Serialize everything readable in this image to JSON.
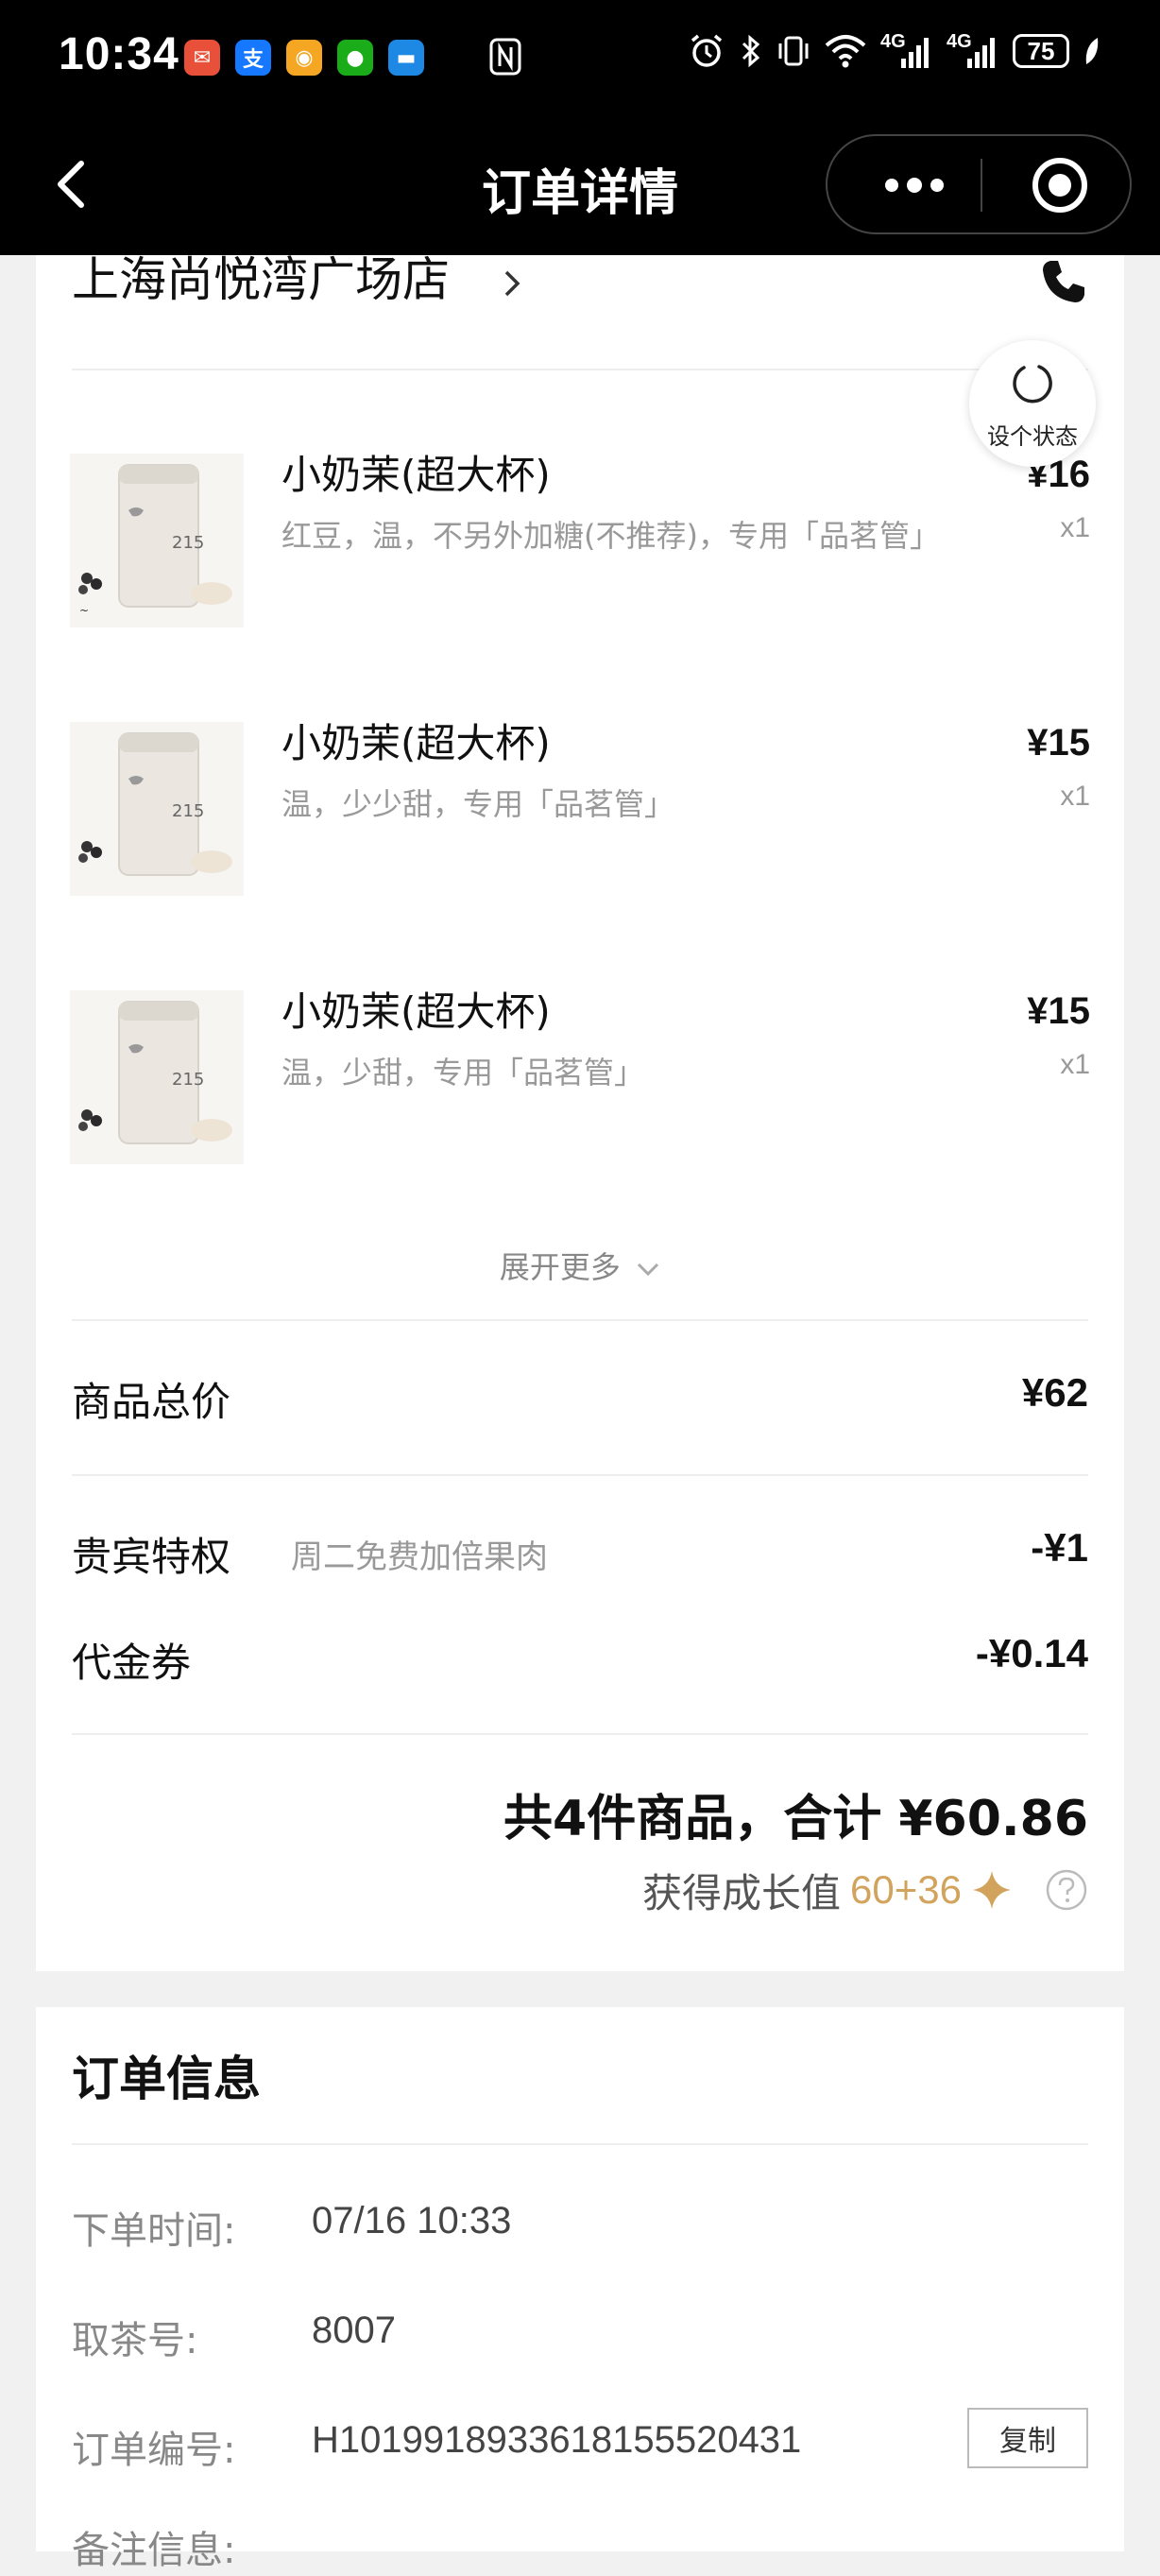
{
  "status_bar": {
    "time": "10:34",
    "battery": "75",
    "network1": "4G",
    "network2": "4G",
    "app_icons": [
      "mail-app-icon",
      "alipay-app-icon",
      "weibo-app-icon",
      "wechat-app-icon",
      "message-app-icon"
    ]
  },
  "nav": {
    "title": "订单详情"
  },
  "store": {
    "name": "上海尚悦湾广场店"
  },
  "status_fab": {
    "label": "设个状态"
  },
  "items": [
    {
      "name": "小奶茉(超大杯)",
      "options": "红豆，温，不另外加糖(不推荐)，专用「品茗管」",
      "price": "¥16",
      "qty": "x1",
      "thumb_text": "215"
    },
    {
      "name": "小奶茉(超大杯)",
      "options": "温，少少甜，专用「品茗管」",
      "price": "¥15",
      "qty": "x1",
      "thumb_text": "215"
    },
    {
      "name": "小奶茉(超大杯)",
      "options": "温，少甜，专用「品茗管」",
      "price": "¥15",
      "qty": "x1",
      "thumb_text": "215"
    }
  ],
  "expand_label": "展开更多",
  "summary": {
    "subtotal_label": "商品总价",
    "subtotal_value": "¥62",
    "vip_label": "贵宾特权",
    "vip_note": "周二免费加倍果肉",
    "vip_value": "-¥1",
    "voucher_label": "代金券",
    "voucher_value": "-¥0.14",
    "total_text": "共4件商品，合计 ¥60.86",
    "growth_label": "获得成长值",
    "growth_value": "60+36"
  },
  "order_info": {
    "title": "订单信息",
    "rows": [
      {
        "key": "下单时间:",
        "value": "07/16 10:33"
      },
      {
        "key": "取茶号:",
        "value": "8007"
      },
      {
        "key": "订单编号:",
        "value": "H1019918933618155520431"
      },
      {
        "key": "备注信息:",
        "value": ""
      }
    ],
    "copy_label": "复制"
  },
  "colors": {
    "gold": "#d2a35c",
    "navbar": "#000000"
  }
}
